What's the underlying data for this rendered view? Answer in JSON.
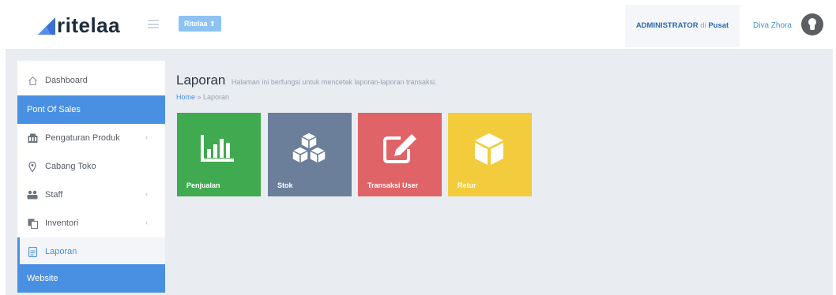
{
  "header": {
    "logo_text": "ritelaa",
    "brand_button": "Ritelaa ⬆",
    "admin_role": "ADMINISTRATOR",
    "admin_di": "di",
    "admin_place": "Pusat",
    "user_name": "Diva Zhora"
  },
  "sidebar": {
    "items": [
      {
        "label": "Dashboard"
      },
      {
        "label": "Pont Of Sales"
      },
      {
        "label": "Pengaturan Produk"
      },
      {
        "label": "Cabang Toko"
      },
      {
        "label": "Staff"
      },
      {
        "label": "Inventori"
      },
      {
        "label": "Laporan"
      },
      {
        "label": "Website"
      }
    ]
  },
  "page": {
    "title": "Laporan",
    "subtitle": "Halaman ini berfungsi untuk mencetak laporan-laporan transaksi.",
    "breadcrumb_home": "Home",
    "breadcrumb_sep": " » ",
    "breadcrumb_current": "Laporan"
  },
  "tiles": [
    {
      "label": "Penjualan",
      "color": "#3faa4f",
      "icon": "bar-chart-icon"
    },
    {
      "label": "Stok",
      "color": "#6b7f9a",
      "icon": "cubes-icon"
    },
    {
      "label": "Transaksi User",
      "color": "#e06467",
      "icon": "edit-icon"
    },
    {
      "label": "Retur",
      "color": "#f2cc3d",
      "icon": "cube-icon"
    }
  ],
  "colors": {
    "accent": "#4a90e2",
    "content_bg": "#e9ecf1"
  }
}
